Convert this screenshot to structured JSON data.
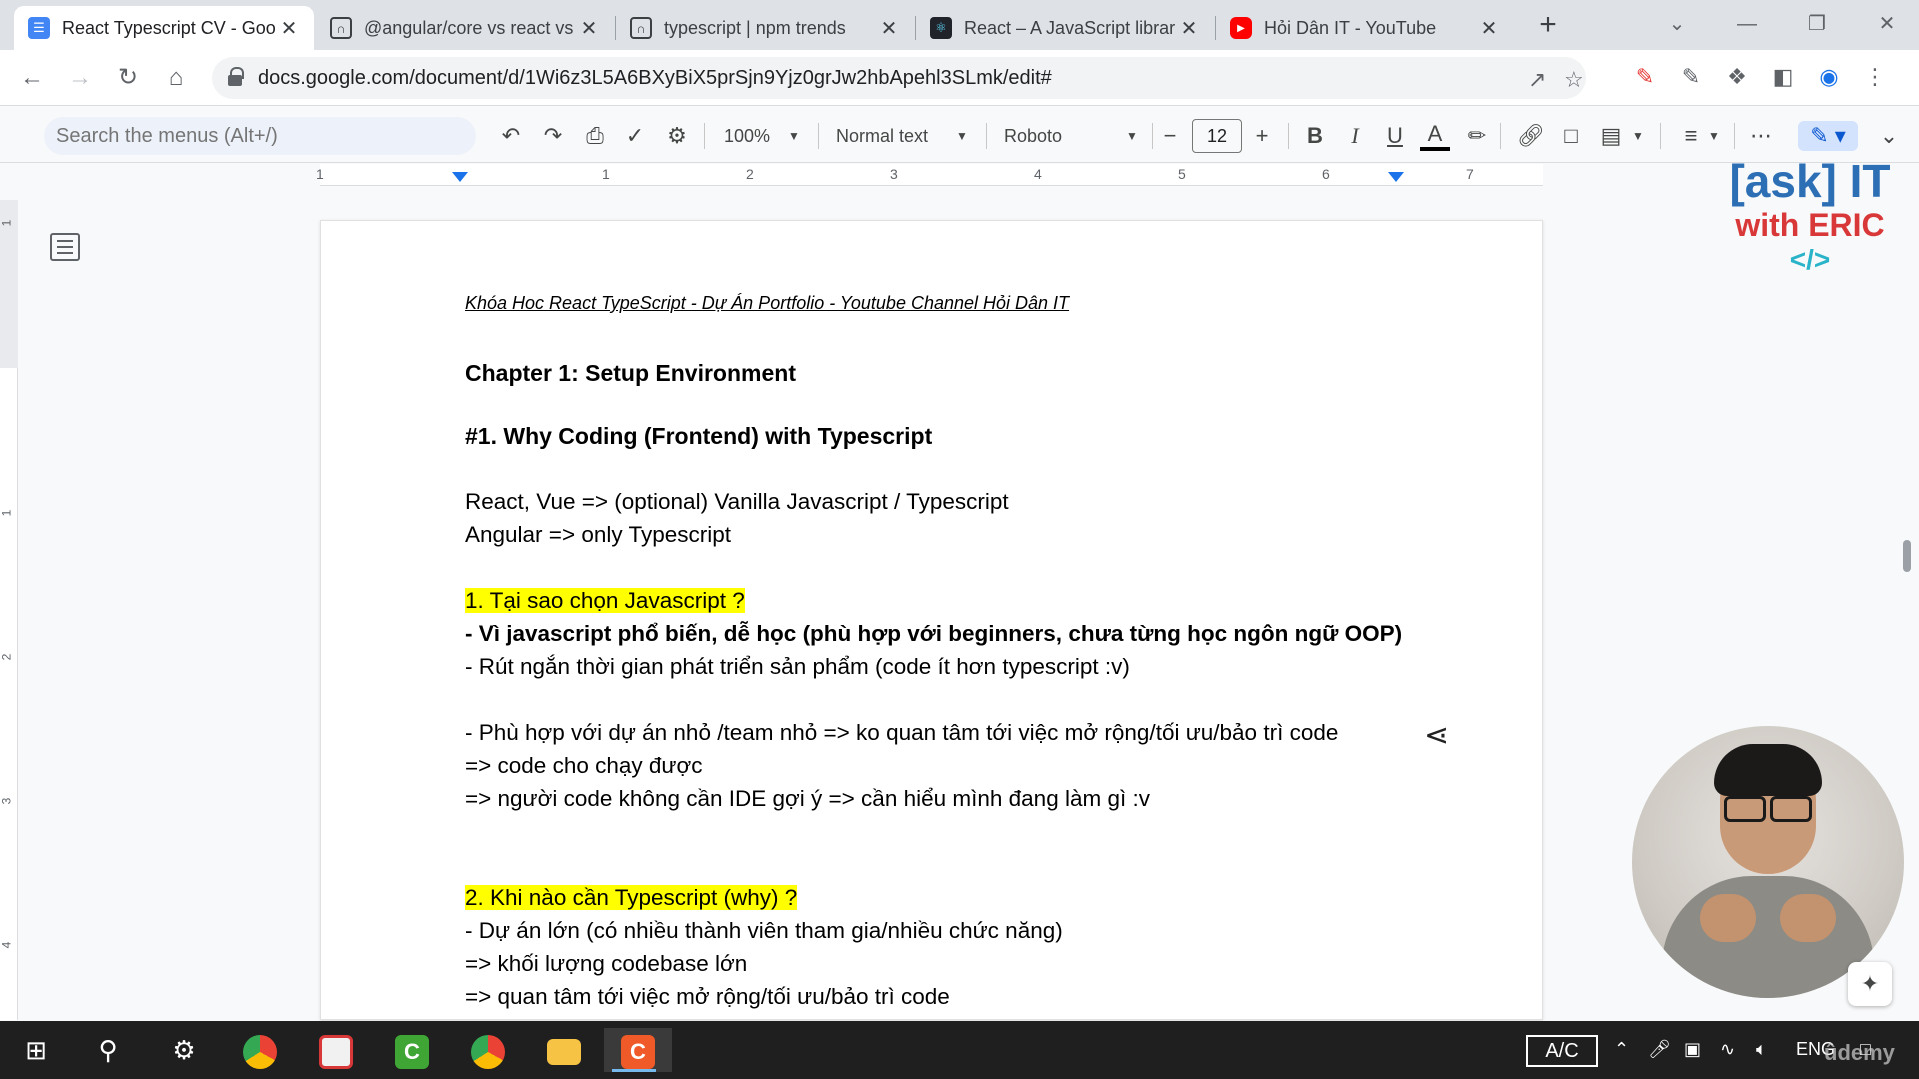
{
  "browser": {
    "tabs": [
      {
        "title": "React Typescript CV - Goo",
        "favicon": "docs-icon",
        "color": "#4285f4",
        "active": true
      },
      {
        "title": "@angular/core vs react vs",
        "favicon": "npm-trends-icon",
        "color": "#ffffff",
        "active": false
      },
      {
        "title": "typescript | npm trends",
        "favicon": "npm-trends-icon",
        "color": "#ffffff",
        "active": false
      },
      {
        "title": "React – A JavaScript librar",
        "favicon": "react-icon",
        "color": "#20232a",
        "active": false
      },
      {
        "title": "Hỏi Dân IT - YouTube",
        "favicon": "youtube-icon",
        "color": "#ff0000",
        "active": false
      }
    ],
    "url": "docs.google.com/document/d/1Wi6z3L5A6BXyBiX5prSjn9Yjz0grJw2hbApehl3SLmk/edit#"
  },
  "docs_toolbar": {
    "search_placeholder": "Search the menus (Alt+/)",
    "zoom": "100%",
    "style": "Normal text",
    "font": "Roboto",
    "font_size": "12"
  },
  "ruler": {
    "numbers": [
      "1",
      "1",
      "2",
      "3",
      "4",
      "5",
      "6",
      "7"
    ]
  },
  "vruler": {
    "numbers": [
      "1",
      "1",
      "2",
      "3",
      "4"
    ]
  },
  "document": {
    "subtitle": "Khóa Hoc React TypeScript - Dự Án Portfolio - Youtube Channel Hỏi Dân IT",
    "chapter": "Chapter 1: Setup Environment",
    "section": "#1. Why Coding (Frontend) with Typescript",
    "p1": "React, Vue => (optional) Vanilla Javascript / Typescript",
    "p2": "Angular => only Typescript",
    "h1": "1. Tại sao chọn Javascript ?",
    "p3": "- Vì javascript phổ biến, dễ học (phù hợp với beginners, chưa từng học ngôn ngữ OOP)",
    "p4": "- Rút ngắn thời gian phát triển sản phẩm (code ít hơn typescript :v)",
    "p5": "- Phù hợp với dự án nhỏ /team nhỏ => ko quan tâm tới việc mở rộng/tối ưu/bảo trì code",
    "p6": "=> code cho chạy được",
    "p7": "=> người code không cần IDE gợi ý => cần hiểu mình đang làm gì :v",
    "h2": "2. Khi nào cần Typescript (why) ?",
    "p8": "- Dự án lớn (có nhiều thành viên tham gia/nhiều chức năng)",
    "p9": "=> khối lượng codebase lớn",
    "p10": "=> quan tâm tới việc mở rộng/tối ưu/bảo trì code"
  },
  "logo": {
    "line1": "[ask] IT",
    "line2": "with ERIC",
    "line3": "</>"
  },
  "taskbar": {
    "ac_label": "A/C",
    "lang": "ENG",
    "watermark": "ûdemy"
  },
  "colors": {
    "highlight": "#ffff00",
    "accent": "#1a73e8"
  }
}
